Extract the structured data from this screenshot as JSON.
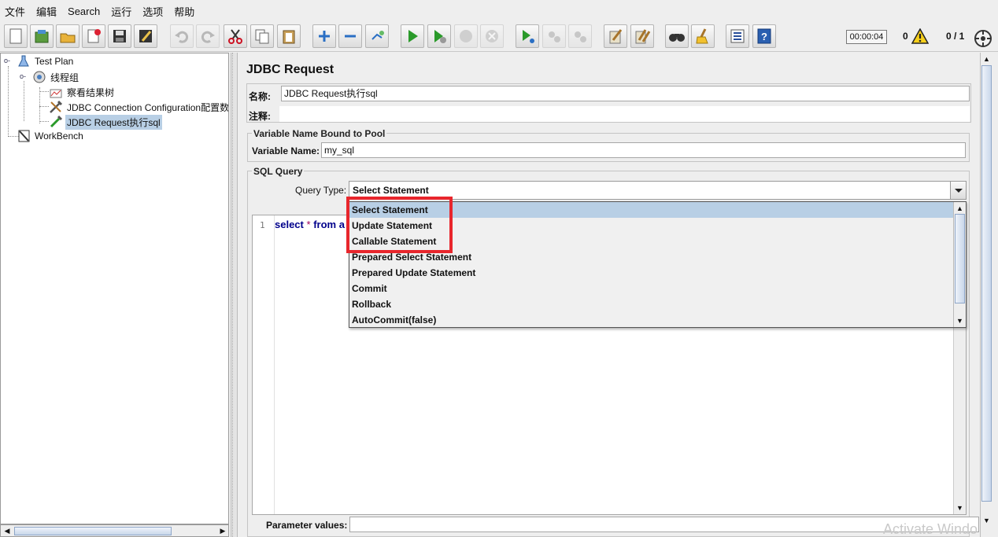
{
  "menu": [
    "文件",
    "编辑",
    "Search",
    "运行",
    "选项",
    "帮助"
  ],
  "toolbar": {
    "icons": [
      "new-icon",
      "templates-icon",
      "open-icon",
      "close-icon",
      "save-icon",
      "save-as-icon",
      "undo-icon",
      "redo-icon",
      "cut-icon",
      "copy-icon",
      "paste-icon",
      "expand-icon",
      "collapse-icon",
      "toggle-icon",
      "start-icon",
      "start-no-pause-icon",
      "stop-icon",
      "shutdown-icon",
      "remote-start-icon",
      "remote-stop-icon",
      "remote-shutdown-icon",
      "clear-icon",
      "clear-all-icon",
      "search-icon",
      "reset-search-icon",
      "function-helper-icon",
      "help-icon"
    ],
    "timer": "00:00:04",
    "error_count": "0",
    "threads": "0 / 1"
  },
  "tree": {
    "nodes": [
      {
        "label": "Test Plan",
        "icon": "test-plan-icon"
      },
      {
        "label": "线程组",
        "icon": "thread-group-icon"
      },
      {
        "label": "察看结果树",
        "icon": "listener-icon"
      },
      {
        "label": "JDBC Connection Configuration配置数",
        "icon": "config-element-icon"
      },
      {
        "label": "JDBC Request执行sql",
        "icon": "sampler-icon"
      },
      {
        "label": "WorkBench",
        "icon": "workbench-icon"
      }
    ]
  },
  "panel": {
    "title": "JDBC Request",
    "name_label": "名称:",
    "name_value": "JDBC Request执行sql",
    "comment_label": "注释:",
    "comment_value": "",
    "pool_group_title": "Variable Name Bound to Pool",
    "variable_name_label": "Variable Name:",
    "variable_name_value": "my_sql",
    "sql_group_title": "SQL Query",
    "query_type_label": "Query Type:",
    "query_type_value": "Select Statement",
    "query_type_options": [
      "Select Statement",
      "Update Statement",
      "Callable Statement",
      "Prepared Select Statement",
      "Prepared Update Statement",
      "Commit",
      "Rollback",
      "AutoCommit(false)"
    ],
    "editor": {
      "line_number": "1",
      "code_kw1": "select",
      "code_star": "*",
      "code_kw2": "from",
      "code_rest": "a"
    },
    "parameter_values_label": "Parameter values:",
    "parameter_values_value": ""
  },
  "watermark": "Activate Windows"
}
